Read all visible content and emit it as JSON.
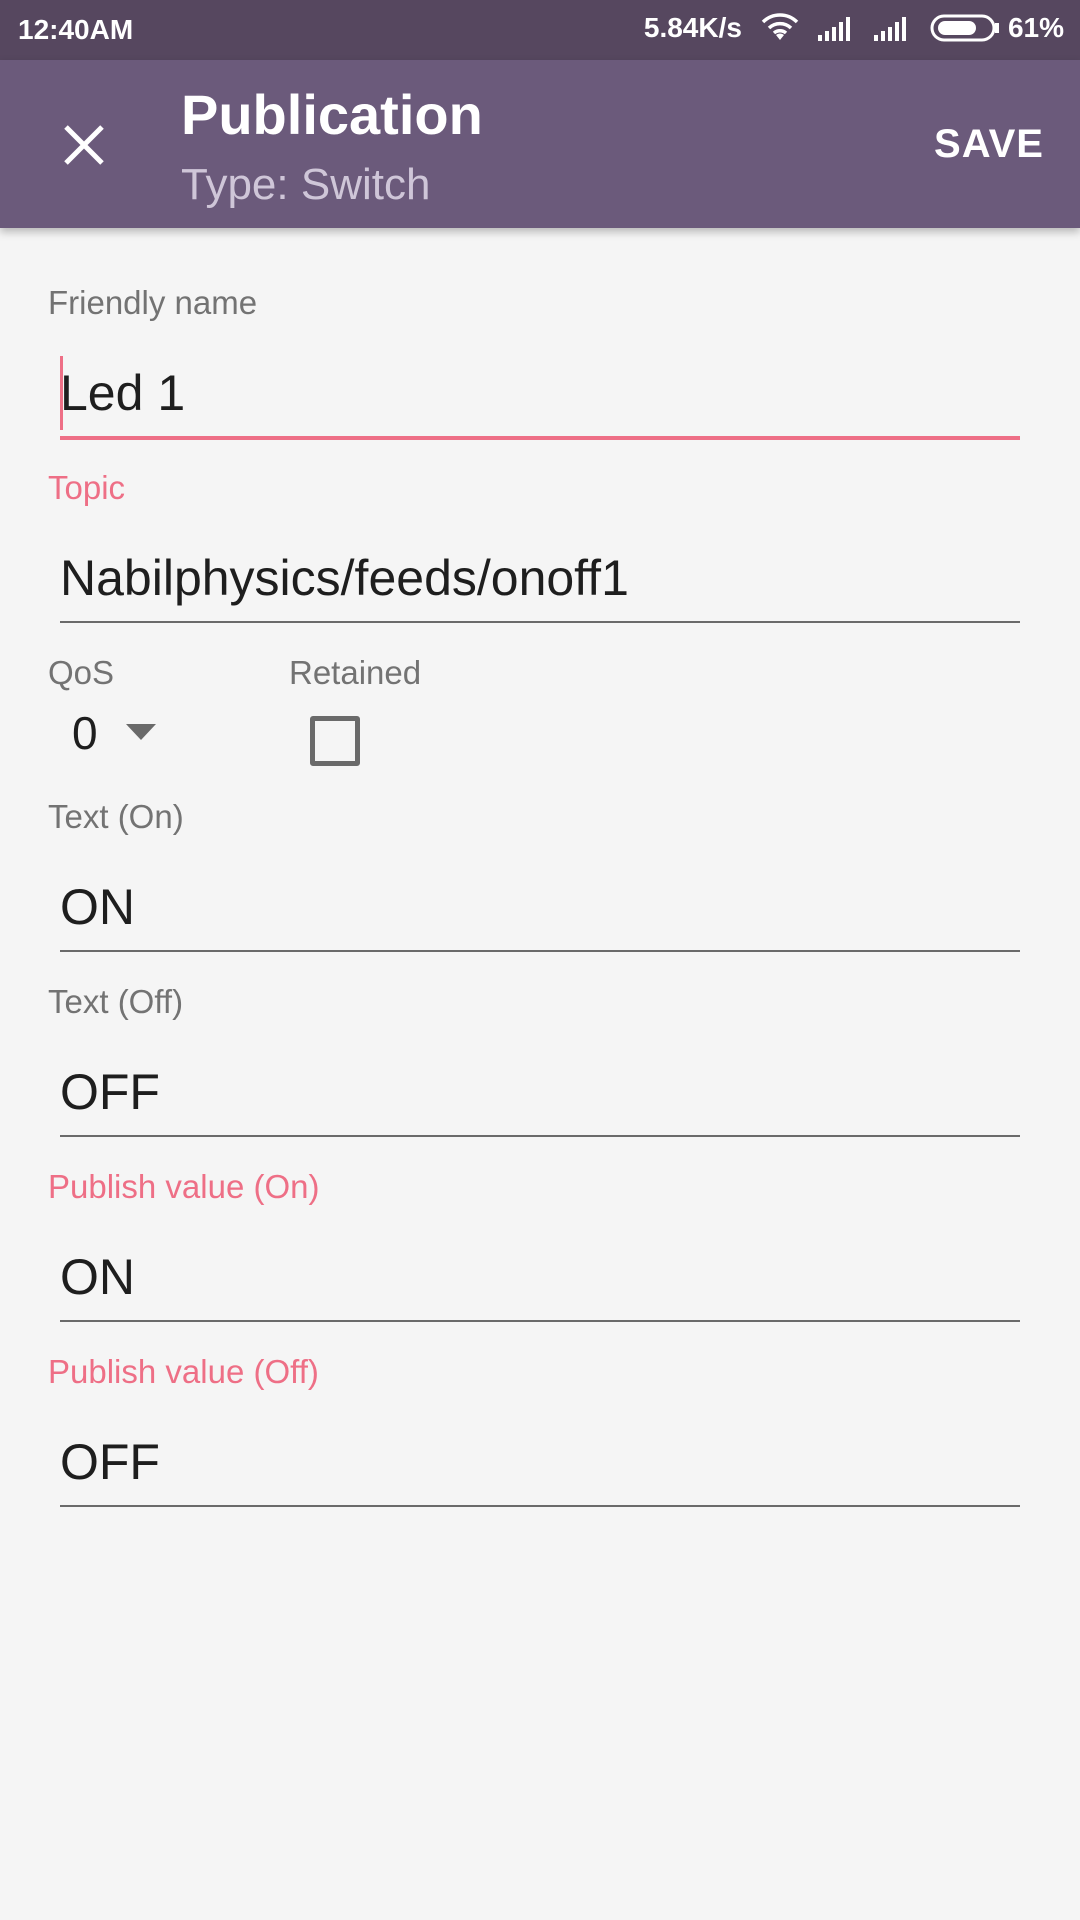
{
  "status_bar": {
    "time": "12:40AM",
    "network_speed": "5.84K/s",
    "battery": "61%",
    "icons": [
      "wifi-icon",
      "signal-icon",
      "signal-icon",
      "battery-icon"
    ]
  },
  "app_bar": {
    "title": "Publication",
    "subtitle": "Type: Switch",
    "save_label": "SAVE",
    "close_icon": "close-icon",
    "color": "#6b5a7b"
  },
  "form": {
    "friendly_name": {
      "label": "Friendly name",
      "value": "Led 1"
    },
    "topic": {
      "label": "Topic",
      "value": "Nabilphysics/feeds/onoff1"
    },
    "qos": {
      "label": "QoS",
      "value": "0"
    },
    "retained": {
      "label": "Retained",
      "checked": false
    },
    "text_on": {
      "label": "Text (On)",
      "value": "ON"
    },
    "text_off": {
      "label": "Text (Off)",
      "value": "OFF"
    },
    "publish_on": {
      "label": "Publish value (On)",
      "value": "ON"
    },
    "publish_off": {
      "label": "Publish value (Off)",
      "value": "OFF"
    }
  },
  "colors": {
    "accent": "#ee6f86",
    "status_bar": "#56475f",
    "background": "#f5f5f5"
  }
}
